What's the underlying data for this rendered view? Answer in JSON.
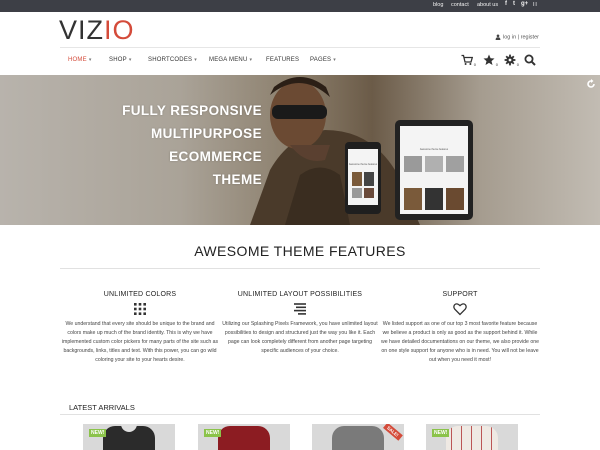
{
  "topbar": {
    "links": [
      "blog",
      "contact",
      "about us"
    ],
    "social_icons": [
      "facebook-icon",
      "twitter-icon",
      "google-plus-icon",
      "rss-icon"
    ],
    "social_glyphs": [
      "f",
      "t",
      "g+",
      "∷"
    ]
  },
  "header": {
    "logo_main": "VIZ",
    "logo_accent": "IO",
    "auth_text": "log in | register"
  },
  "nav": {
    "items": [
      {
        "label": "HOME",
        "caret": "▾"
      },
      {
        "label": "SHOP",
        "caret": "▾"
      },
      {
        "label": "SHORTCODES",
        "caret": "▾"
      },
      {
        "label": "MEGA MENU",
        "caret": "▾"
      },
      {
        "label": "FEATURES",
        "caret": ""
      },
      {
        "label": "PAGES",
        "caret": "▾"
      }
    ],
    "cart_count": "0",
    "wishlist_count": "0",
    "compare_count": "0"
  },
  "hero": {
    "lines": [
      "FULLY RESPONSIVE",
      "MULTIPURPOSE",
      "ECOMMERCE",
      "THEME"
    ],
    "tablet_caption": "Awesome theme features",
    "phone_caption": "Awesome theme features"
  },
  "features": {
    "title": "AWESOME THEME FEATURES",
    "items": [
      {
        "title": "UNLIMITED COLORS",
        "icon": "grid-icon",
        "text": "We understand that every site should be unique to the brand and colors make up much of the brand identity. This is why we have implemented custom color pickers for many parts of the site such as backgrounds, links, titles and text. With this power, you can go wild coloring your site to your hearts desire."
      },
      {
        "title": "UNLIMITED LAYOUT POSSIBILITIES",
        "icon": "align-icon",
        "text": "Utilizing our Splashing Pixels Framework, you have unlimited layout possibilities to design and structured just the way you like it. Each page can look completely different from another page targeting specific audiences of your choice."
      },
      {
        "title": "SUPPORT",
        "icon": "heart-icon",
        "text": "We listed support as one of our top 3 most favorite feature because we believe a product is only as good as the support behind it. While we have detailed documentations on our theme, we also provide one on one style support for anyone who is in need. You will not be leave out when you need it most!"
      }
    ]
  },
  "latest": {
    "title": "LATEST ARRIVALS",
    "products": [
      {
        "badge": "NEW!",
        "sale": "",
        "color": "#2b2b2b",
        "accent": "#d8d8d8"
      },
      {
        "badge": "NEW!",
        "sale": "",
        "color": "#8c1c22",
        "accent": "#8c1c22"
      },
      {
        "badge": "",
        "sale": "SALE!",
        "color": "#7a7a7a",
        "accent": "#7a7a7a"
      },
      {
        "badge": "NEW!",
        "sale": "",
        "color": "#e7e2dc",
        "accent": "#b33"
      }
    ]
  },
  "colors": {
    "accent": "#d44b3a",
    "topbar": "#3d3f46",
    "new_badge": "#8bc34a"
  }
}
